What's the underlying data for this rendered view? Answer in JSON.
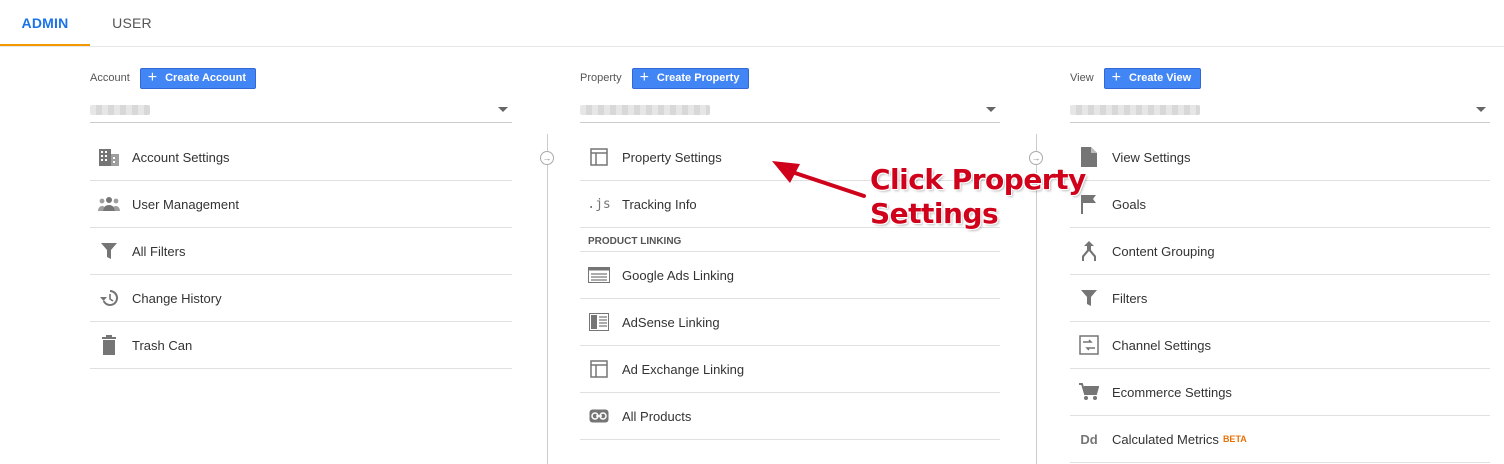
{
  "tabs": {
    "admin": "ADMIN",
    "user": "USER"
  },
  "account": {
    "label": "Account",
    "create": "Create Account",
    "items": [
      {
        "label": "Account Settings",
        "icon": "building-icon"
      },
      {
        "label": "User Management",
        "icon": "people-icon"
      },
      {
        "label": "All Filters",
        "icon": "filter-icon"
      },
      {
        "label": "Change History",
        "icon": "history-icon"
      },
      {
        "label": "Trash Can",
        "icon": "trash-icon"
      }
    ]
  },
  "property": {
    "label": "Property",
    "create": "Create Property",
    "items": [
      {
        "label": "Property Settings",
        "icon": "layout-icon"
      },
      {
        "label": "Tracking Info",
        "icon": "js-icon",
        "glyph": ".js"
      }
    ],
    "section": "PRODUCT LINKING",
    "linking": [
      {
        "label": "Google Ads Linking",
        "icon": "ads-icon"
      },
      {
        "label": "AdSense Linking",
        "icon": "adsense-icon"
      },
      {
        "label": "Ad Exchange Linking",
        "icon": "layout-icon"
      },
      {
        "label": "All Products",
        "icon": "link-icon"
      }
    ]
  },
  "view": {
    "label": "View",
    "create": "Create View",
    "items": [
      {
        "label": "View Settings",
        "icon": "document-icon"
      },
      {
        "label": "Goals",
        "icon": "flag-icon"
      },
      {
        "label": "Content Grouping",
        "icon": "grouping-icon"
      },
      {
        "label": "Filters",
        "icon": "filter-icon"
      },
      {
        "label": "Channel Settings",
        "icon": "channel-icon"
      },
      {
        "label": "Ecommerce Settings",
        "icon": "cart-icon"
      },
      {
        "label": "Calculated Metrics",
        "icon": "dd-icon",
        "glyph": "Dd",
        "badge": "BETA"
      }
    ]
  },
  "annotation": {
    "line1": "Click Property",
    "line2": "Settings"
  },
  "colors": {
    "accent": "#4285f4",
    "tab_underline": "#f29900",
    "annotation": "#d0021b"
  }
}
